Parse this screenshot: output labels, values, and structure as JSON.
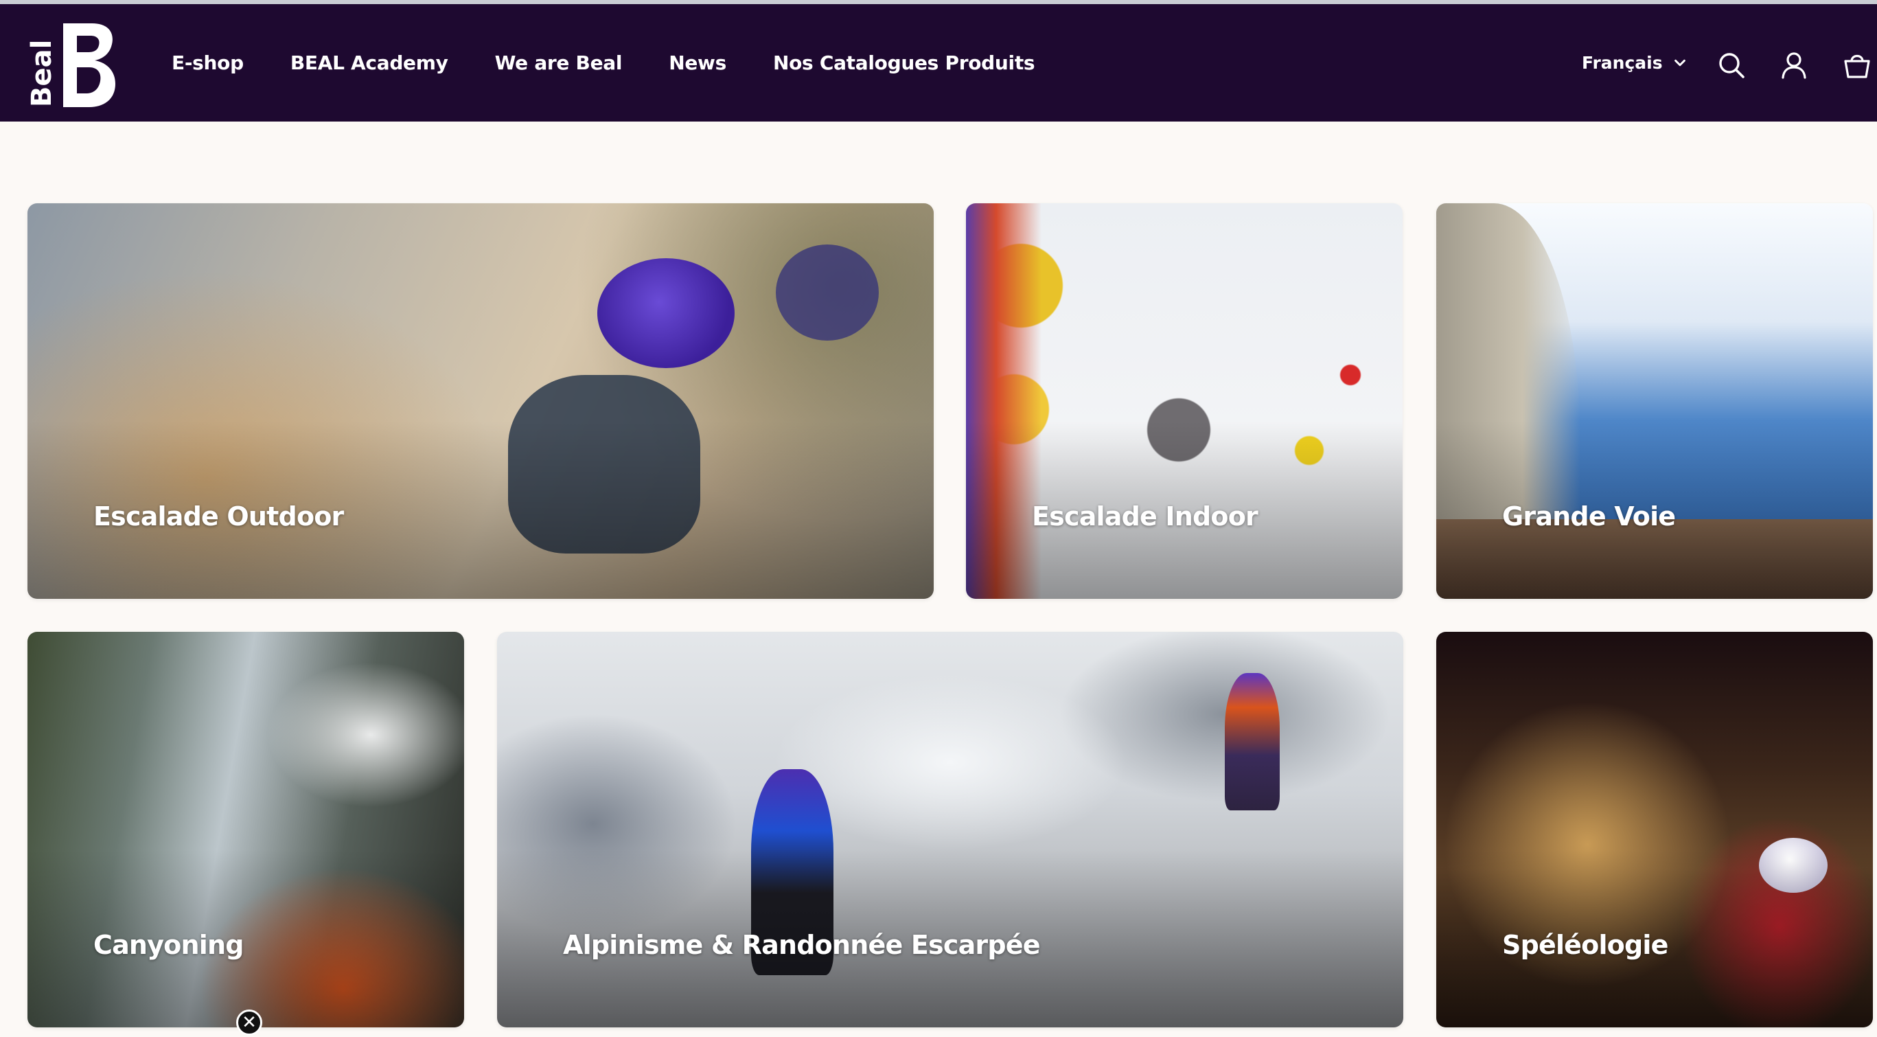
{
  "brand": {
    "name": "Beal",
    "logo_text": "Beal",
    "colors": {
      "header_bg": "#1e0930",
      "page_bg": "#fcf9f6",
      "accent_purple": "#4b2bb0"
    }
  },
  "nav": {
    "items": [
      {
        "label": "E-shop"
      },
      {
        "label": "BEAL Academy"
      },
      {
        "label": "We are Beal"
      },
      {
        "label": "News"
      },
      {
        "label": "Nos Catalogues Produits"
      }
    ]
  },
  "header_right": {
    "language": "Français",
    "icons": [
      "chevron-down-icon",
      "search-icon",
      "account-icon",
      "cart-icon"
    ]
  },
  "categories": [
    {
      "label": "Escalade Outdoor"
    },
    {
      "label": "Escalade Indoor"
    },
    {
      "label": "Grande Voie"
    },
    {
      "label": "Canyoning"
    },
    {
      "label": "Alpinisme & Randonnée Escarpée"
    },
    {
      "label": "Spéléologie"
    }
  ],
  "overlay": {
    "close_glyph": "✕"
  }
}
